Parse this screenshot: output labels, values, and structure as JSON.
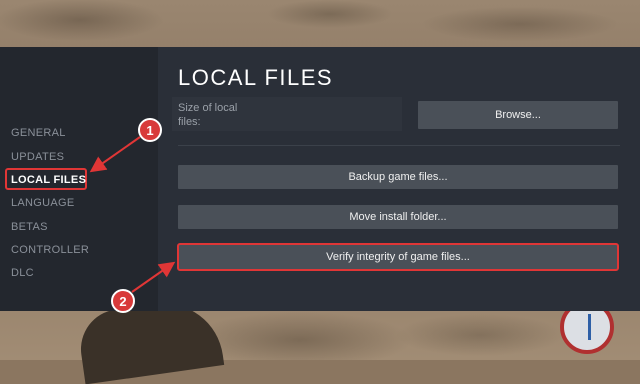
{
  "sidebar": {
    "items": [
      {
        "label": "GENERAL",
        "active": false
      },
      {
        "label": "UPDATES",
        "active": false
      },
      {
        "label": "LOCAL FILES",
        "active": true
      },
      {
        "label": "LANGUAGE",
        "active": false
      },
      {
        "label": "BETAS",
        "active": false
      },
      {
        "label": "CONTROLLER",
        "active": false
      },
      {
        "label": "DLC",
        "active": false
      }
    ]
  },
  "main": {
    "title": "LOCAL FILES",
    "size_label": "Size of local files:",
    "browse_label": "Browse...",
    "backup_label": "Backup game files...",
    "move_label": "Move install folder...",
    "verify_label": "Verify integrity of game files..."
  },
  "callouts": {
    "one": "1",
    "two": "2"
  },
  "colors": {
    "highlight": "#e03636",
    "dialog_bg": "#2a2f38",
    "sidebar_bg": "#23272e",
    "button_bg": "#4a5058"
  }
}
